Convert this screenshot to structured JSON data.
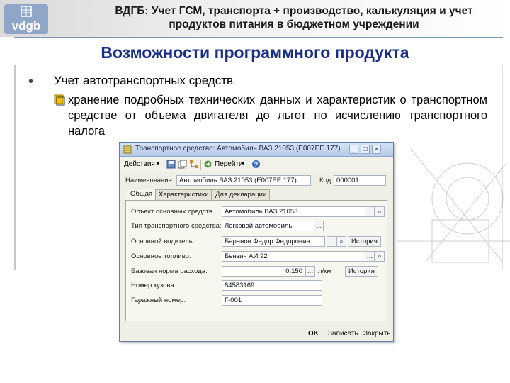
{
  "slide": {
    "header": "ВДГБ: Учет ГСМ, транспорта + производство, калькуляция и учет продуктов питания в бюджетном учреждении",
    "logo_text": "vdgb",
    "title": "Возможности программного продукта",
    "bullet_level1": "Учет автотранспортных средств",
    "bullet_level2": "хранение подробных технических данных и характеристик о транспортном средстве от объема двигателя до льгот по исчислению транспортного налога"
  },
  "window": {
    "title": "Транспортное средство: Автомобиль ВАЗ 21053 (Е007ЕЕ 177)",
    "controls": [
      "_",
      "□",
      "×"
    ],
    "toolbar": {
      "actions": "Действия",
      "goto": "Перейти"
    },
    "name_label": "Наименование:",
    "name_value": "Автомобиль ВАЗ 21053 (Е007ЕЕ 177)",
    "code_label": "Код:",
    "code_value": "000001",
    "tabs": [
      "Общая",
      "Характеристики",
      "Для декларации"
    ],
    "fields": {
      "asset_label": "Объект основных средств",
      "asset_value": "Автомобиль ВАЗ 21053",
      "vehicle_type_label": "Тип транспортного средства:",
      "vehicle_type_value": "Легковой автомобиль",
      "driver_label": "Основной водитель:",
      "driver_value": "Баранов Федор Федорович",
      "fuel_label": "Основное топливо:",
      "fuel_value": "Бензин АИ 92",
      "consumption_label": "Базовая норма расхода:",
      "consumption_value": "0,150",
      "consumption_unit": "л/км",
      "body_label": "Номер кузова:",
      "body_value": "84583169",
      "garage_label": "Гаражный номер:",
      "garage_value": "Г-001",
      "history_label": "История"
    },
    "footer": {
      "ok": "OK",
      "save": "Записать",
      "close": "Закрыть"
    }
  }
}
